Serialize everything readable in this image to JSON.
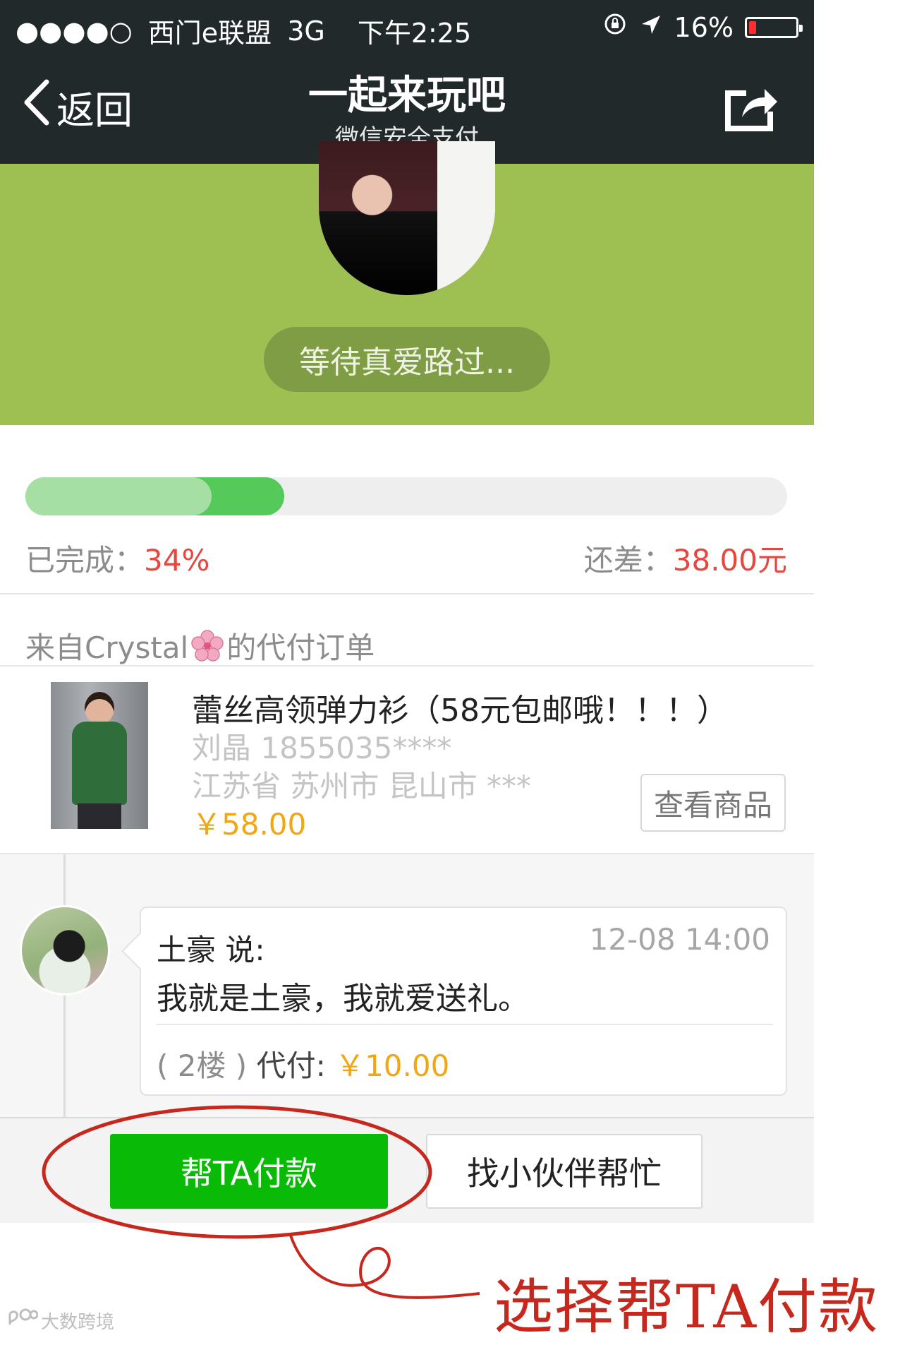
{
  "status_bar": {
    "signal": "●●●●○",
    "carrier": "西门e联盟",
    "network": "3G",
    "time": "下午2:25",
    "battery_percent": "16%",
    "battery_level": 0.16,
    "icons": [
      "rotation-lock-icon",
      "location-arrow-icon",
      "battery-icon"
    ]
  },
  "nav": {
    "back_label": "返回",
    "title": "一起来玩吧",
    "subtitle": "微信安全支付",
    "share_icon": "share-icon"
  },
  "header": {
    "status_text": "等待真爱路过..."
  },
  "progress": {
    "completed_label": "已完成：",
    "completed_value": "34%",
    "completed_fraction": 0.34,
    "remaining_label": "还差：",
    "remaining_value": "38.00元"
  },
  "order": {
    "from_prefix": "来自Crystal",
    "from_suffix": "的代付订单",
    "product": {
      "title": "蕾丝高领弹力衫（58元包邮哦！！！）",
      "recipient": "刘晶  1855035****",
      "address": "江苏省 苏州市 昆山市 ***",
      "price": "￥58.00",
      "view_button": "查看商品"
    }
  },
  "message": {
    "author": "土豪 说:",
    "time": "12-08 14:00",
    "text": "我就是土豪，我就爱送礼。",
    "floor": "( 2楼 )",
    "pay_label": "代付:",
    "amount": "￥10.00"
  },
  "actions": {
    "pay_button": "帮TA付款",
    "friend_button": "找小伙伴帮忙"
  },
  "annotation": {
    "caption": "选择帮TA付款",
    "color": "#c6281d"
  },
  "watermark": {
    "text": "大数跨境"
  },
  "colors": {
    "nav_bg": "#22292b",
    "header_green": "#9ec053",
    "progress_green": "#55c95a",
    "accent_red": "#e8463e",
    "price_orange": "#f2a712",
    "pay_button_green": "#09bb07"
  }
}
